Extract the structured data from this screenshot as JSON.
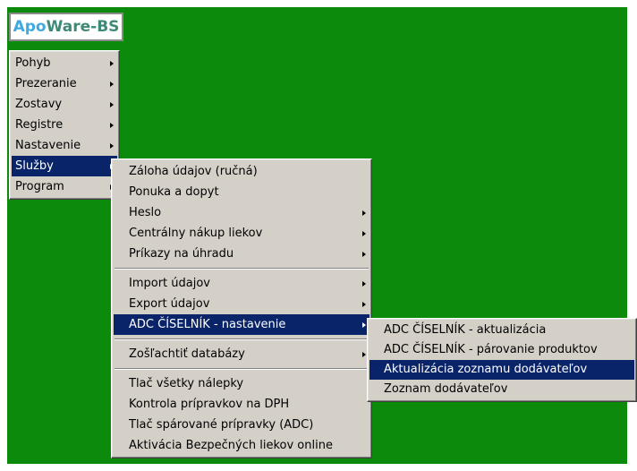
{
  "app": {
    "logo_part1": "Apo",
    "logo_part2": "Ware-BS"
  },
  "main_menu": {
    "items": [
      {
        "label": "Pohyb"
      },
      {
        "label": "Prezeranie"
      },
      {
        "label": "Zostavy"
      },
      {
        "label": "Registre"
      },
      {
        "label": "Nastavenie"
      },
      {
        "label": "Služby",
        "highlighted": true
      },
      {
        "label": "Program"
      }
    ]
  },
  "sluzby_menu": {
    "items": [
      {
        "label": "Záloha údajov (ručná)",
        "submenu": false
      },
      {
        "label": "Ponuka a dopyt",
        "submenu": false
      },
      {
        "label": "Heslo",
        "submenu": true
      },
      {
        "label": "Centrálny nákup liekov",
        "submenu": true
      },
      {
        "label": "Príkazy na úhradu",
        "submenu": true
      },
      {
        "label": "Import údajov",
        "submenu": true
      },
      {
        "label": "Export údajov",
        "submenu": true
      },
      {
        "label": "ADC ČÍSELNÍK - nastavenie",
        "submenu": true,
        "highlighted": true
      },
      {
        "label": "Zošľachtiť databázy",
        "submenu": true
      },
      {
        "label": "Tlač všetky nálepky",
        "submenu": false
      },
      {
        "label": "Kontrola prípravkov na DPH",
        "submenu": false
      },
      {
        "label": "Tlač spárované prípravky (ADC)",
        "submenu": false
      },
      {
        "label": "Aktivácia Bezpečných liekov online",
        "submenu": false
      }
    ]
  },
  "adc_menu": {
    "items": [
      {
        "label": "ADC ČÍSELNÍK - aktualizácia"
      },
      {
        "label": "ADC ČÍSELNÍK - párovanie produktov"
      },
      {
        "label": "Aktualizácia zoznamu dodávateľov",
        "highlighted": true
      },
      {
        "label": "Zoznam dodávateľov"
      }
    ]
  },
  "colors": {
    "desktop": "#0c8a0c",
    "menu_bg": "#d4d0c8",
    "highlight": "#0a246a"
  }
}
